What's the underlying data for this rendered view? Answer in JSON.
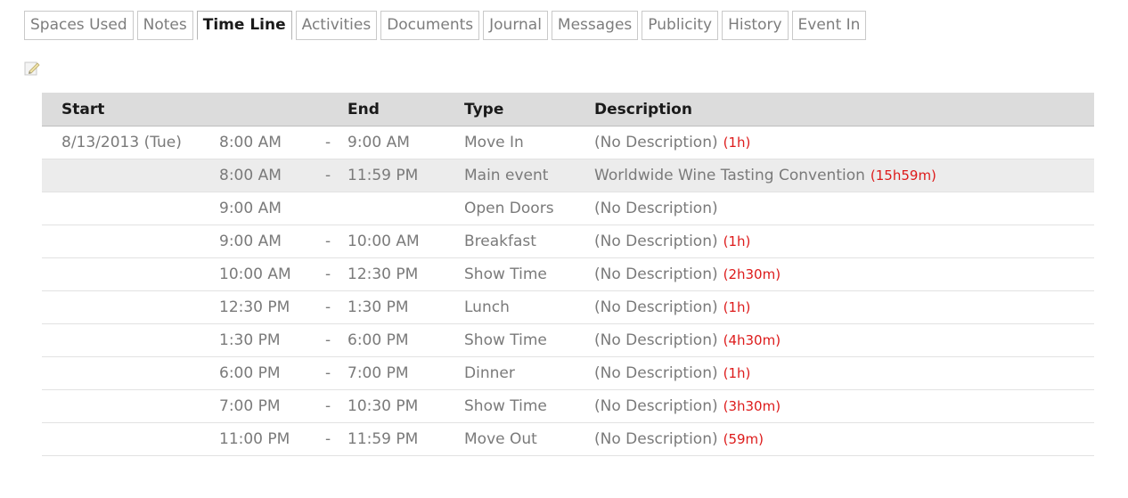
{
  "tabs": [
    {
      "label": "Spaces Used",
      "active": false
    },
    {
      "label": "Notes",
      "active": false
    },
    {
      "label": "Time Line",
      "active": true
    },
    {
      "label": "Activities",
      "active": false
    },
    {
      "label": "Documents",
      "active": false
    },
    {
      "label": "Journal",
      "active": false
    },
    {
      "label": "Messages",
      "active": false
    },
    {
      "label": "Publicity",
      "active": false
    },
    {
      "label": "History",
      "active": false
    },
    {
      "label": "Event In",
      "active": false
    }
  ],
  "edit_icon": "pencil-icon",
  "table": {
    "headers": {
      "start": "Start",
      "end": "End",
      "type": "Type",
      "description": "Description"
    },
    "rows": [
      {
        "date": "8/13/2013 (Tue)",
        "start": "8:00 AM",
        "dash": "-",
        "end": "9:00 AM",
        "type": "Move In",
        "description": "(No Description)",
        "duration": "(1h)"
      },
      {
        "date": "",
        "start": "8:00 AM",
        "dash": "-",
        "end": "11:59 PM",
        "type": "Main event",
        "description": "Worldwide Wine Tasting Convention",
        "duration": "(15h59m)"
      },
      {
        "date": "",
        "start": "9:00 AM",
        "dash": "",
        "end": "",
        "type": "Open Doors",
        "description": "(No Description)",
        "duration": ""
      },
      {
        "date": "",
        "start": "9:00 AM",
        "dash": "-",
        "end": "10:00 AM",
        "type": "Breakfast",
        "description": "(No Description)",
        "duration": "(1h)"
      },
      {
        "date": "",
        "start": "10:00 AM",
        "dash": "-",
        "end": "12:30 PM",
        "type": "Show Time",
        "description": "(No Description)",
        "duration": "(2h30m)"
      },
      {
        "date": "",
        "start": "12:30 PM",
        "dash": "-",
        "end": "1:30 PM",
        "type": "Lunch",
        "description": "(No Description)",
        "duration": "(1h)"
      },
      {
        "date": "",
        "start": "1:30 PM",
        "dash": "-",
        "end": "6:00 PM",
        "type": "Show Time",
        "description": "(No Description)",
        "duration": "(4h30m)"
      },
      {
        "date": "",
        "start": "6:00 PM",
        "dash": "-",
        "end": "7:00 PM",
        "type": "Dinner",
        "description": "(No Description)",
        "duration": "(1h)"
      },
      {
        "date": "",
        "start": "7:00 PM",
        "dash": "-",
        "end": "10:30 PM",
        "type": "Show Time",
        "description": "(No Description)",
        "duration": "(3h30m)"
      },
      {
        "date": "",
        "start": "11:00 PM",
        "dash": "-",
        "end": "11:59 PM",
        "type": "Move Out",
        "description": "(No Description)",
        "duration": "(59m)"
      }
    ]
  },
  "colors": {
    "header_bg": "#dcdcdc",
    "shaded_row": "#ececec",
    "duration": "#dd1b1b",
    "muted_text": "#7a7a7a"
  }
}
